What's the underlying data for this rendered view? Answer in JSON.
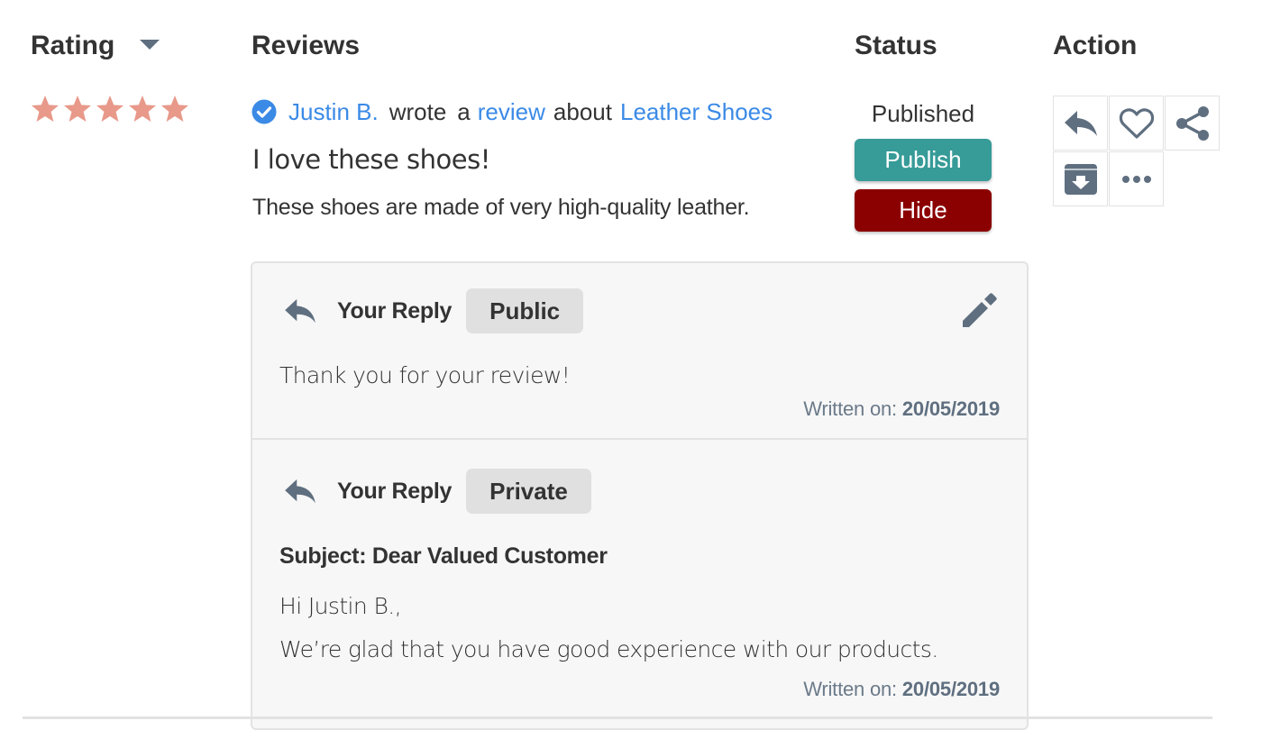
{
  "columns": {
    "rating": "Rating",
    "reviews": "Reviews",
    "status": "Status",
    "action": "Action"
  },
  "sort": {
    "column": "rating",
    "direction": "descending",
    "icon": "caret-down-icon"
  },
  "colors": {
    "star": "#e8998a",
    "link": "#3b8ae6",
    "verified": "#3b8ae6",
    "publish_button": "#379b98",
    "hide_button": "#8b0000",
    "icon": "#5f6f80",
    "badge_bg": "#e0e0e0",
    "card_bg": "#f7f7f7"
  },
  "review": {
    "rating": 5,
    "rating_max": 5,
    "verified_icon": "check-circle-icon",
    "author": "Justin B.",
    "wrote": "wrote",
    "article": "a",
    "review_link": "review",
    "about": "about",
    "product": "Leather Shoes",
    "title": "I love these shoes!",
    "body": "These shoes are made of very high-quality leather."
  },
  "status": {
    "current": "Published",
    "publish_label": "Publish",
    "hide_label": "Hide"
  },
  "actions": [
    {
      "name": "reply",
      "icon": "reply-icon"
    },
    {
      "name": "like",
      "icon": "heart-outline-icon"
    },
    {
      "name": "share",
      "icon": "share-icon"
    },
    {
      "name": "archive",
      "icon": "archive-icon"
    },
    {
      "name": "more",
      "icon": "more-horizontal-icon"
    }
  ],
  "replies": [
    {
      "label": "Your Reply",
      "visibility": "Public",
      "text": "Thank you for your review!",
      "written_label": "Written on:",
      "date": "20/05/2019",
      "editable": true
    },
    {
      "label": "Your Reply",
      "visibility": "Private",
      "subject": "Subject: Dear Valued Customer",
      "greeting": "Hi Justin B.,",
      "text": "We’re glad that you have good experience with our products.",
      "written_label": "Written on:",
      "date": "20/05/2019"
    }
  ]
}
